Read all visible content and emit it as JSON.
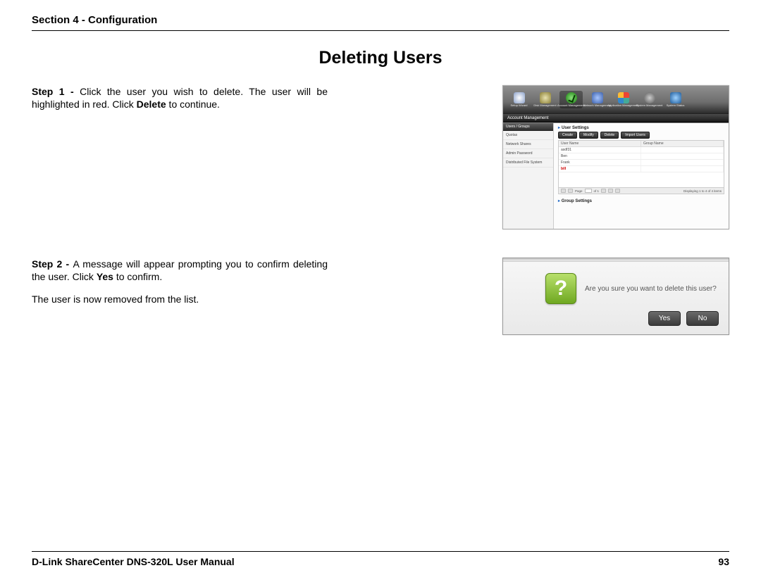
{
  "header": {
    "section": "Section 4 - Configuration"
  },
  "title": "Deleting Users",
  "step1": {
    "label": "Step 1 - ",
    "text_a": "Click the user you wish to delete. The user will be highlighted in red. Click ",
    "bold1": "Delete",
    "text_b": " to continue."
  },
  "step2": {
    "label": "Step 2 - ",
    "text_a": "A message will appear prompting you to confirm deleting the user. Click ",
    "bold1": "Yes",
    "text_b": " to confirm.",
    "after": "The user is now removed from the list."
  },
  "shot1": {
    "toolbar": [
      {
        "label": "Setup Wizard"
      },
      {
        "label": "Disk\nManagement"
      },
      {
        "label": "Account\nManagement",
        "active": true
      },
      {
        "label": "Network\nManagement"
      },
      {
        "label": "Application\nManagement"
      },
      {
        "label": "System\nManagement"
      },
      {
        "label": "System Status"
      }
    ],
    "panel_title": "Account Management",
    "side_tab": "Users / Groups",
    "side_items": [
      "Quotas",
      "Network Shares",
      "Admin Password",
      "Distributed File System"
    ],
    "sec_user": "User Settings",
    "btns": [
      "Create",
      "Modify",
      "Delete",
      "Import Users"
    ],
    "cols": [
      "User Name",
      "Group Name"
    ],
    "rows": [
      {
        "user": "asdf31",
        "group": ""
      },
      {
        "user": "Ben",
        "group": ""
      },
      {
        "user": "Frank",
        "group": ""
      },
      {
        "user": "bill",
        "group": "",
        "red": true
      }
    ],
    "pager": {
      "page_label": "Page",
      "page": "1",
      "of": "of 1",
      "info": "Displaying 1 to 4 of 4 items"
    },
    "sec_group": "Group Settings"
  },
  "shot2": {
    "text": "Are you sure you want to delete this user?",
    "yes": "Yes",
    "no": "No"
  },
  "footer": {
    "left": "D-Link ShareCenter DNS-320L User Manual",
    "right": "93"
  }
}
